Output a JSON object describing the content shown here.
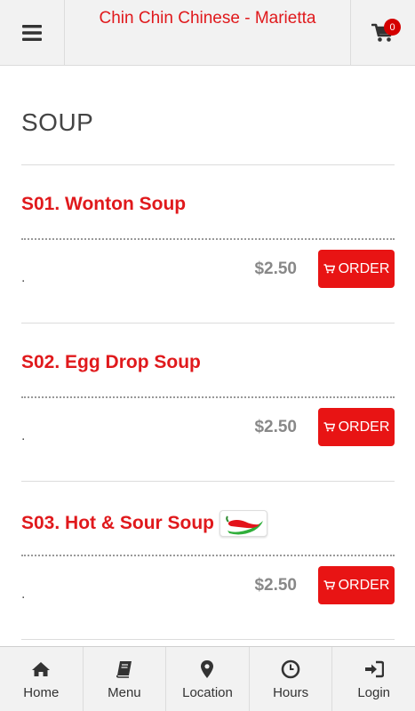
{
  "header": {
    "title": "Chin Chin Chinese - Marietta",
    "cart_count": "0"
  },
  "section": {
    "title": "SOUP"
  },
  "items": [
    {
      "name": "S01. Wonton Soup",
      "desc": ".",
      "price": "$2.50",
      "order_label": "ORDER",
      "spicy": false
    },
    {
      "name": "S02. Egg Drop Soup",
      "desc": ".",
      "price": "$2.50",
      "order_label": "ORDER",
      "spicy": false
    },
    {
      "name": "S03. Hot & Sour Soup",
      "desc": ".",
      "price": "$2.50",
      "order_label": "ORDER",
      "spicy": true
    }
  ],
  "bottom_nav": [
    {
      "label": "Home",
      "icon": "home-icon"
    },
    {
      "label": "Menu",
      "icon": "book-icon"
    },
    {
      "label": "Location",
      "icon": "map-pin-icon"
    },
    {
      "label": "Hours",
      "icon": "clock-icon"
    },
    {
      "label": "Login",
      "icon": "sign-in-icon"
    }
  ],
  "colors": {
    "accent": "#e0191c",
    "button": "#e81414",
    "badge": "#d40000"
  }
}
